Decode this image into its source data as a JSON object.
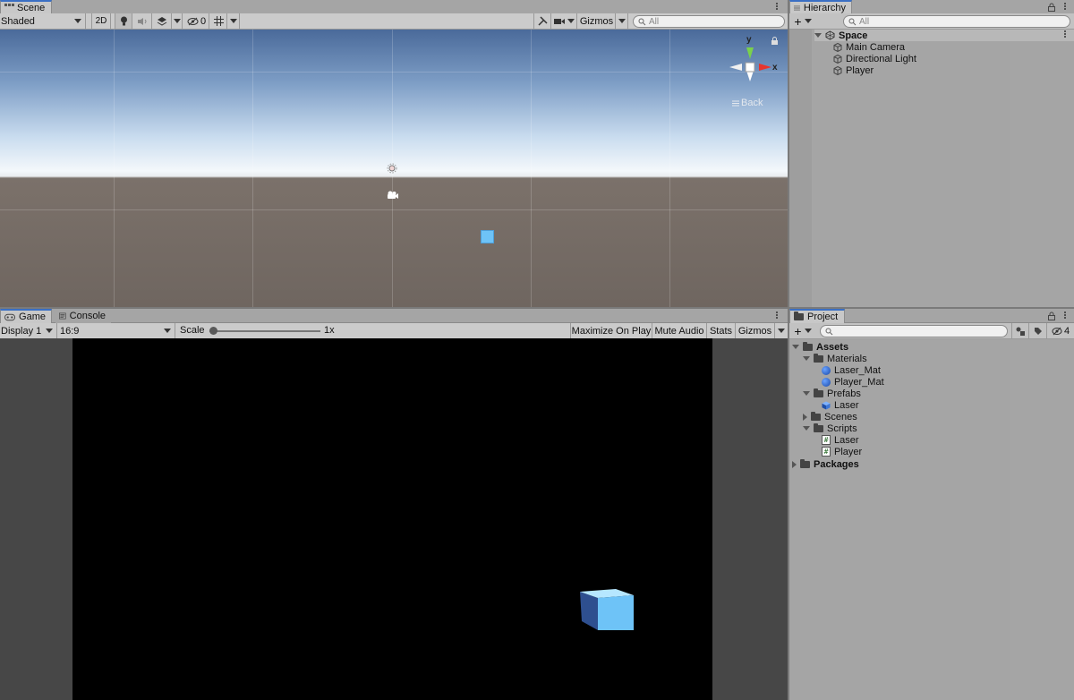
{
  "scene_tab": {
    "label": "Scene"
  },
  "scene_toolbar": {
    "shading_mode": "Shaded",
    "mode_2d": "2D",
    "hidden_count": "0",
    "gizmos_label": "Gizmos",
    "search_placeholder": "All"
  },
  "scene_gizmo": {
    "y_label": "y",
    "x_label": "x",
    "view_label": "Back"
  },
  "hierarchy": {
    "tab_label": "Hierarchy",
    "search_placeholder": "All",
    "scene_name": "Space",
    "items": [
      {
        "label": "Main Camera"
      },
      {
        "label": "Directional Light"
      },
      {
        "label": "Player"
      }
    ]
  },
  "game_tabs": [
    {
      "label": "Game"
    },
    {
      "label": "Console"
    }
  ],
  "game_toolbar": {
    "display": "Display 1",
    "aspect": "16:9",
    "scale_label": "Scale",
    "scale_value": "1x",
    "scale_fraction": 0,
    "maximize_label": "Maximize On Play",
    "mute_label": "Mute Audio",
    "stats_label": "Stats",
    "gizmos_label": "Gizmos"
  },
  "project": {
    "tab_label": "Project",
    "hidden_count": "4",
    "tree": {
      "assets": "Assets",
      "materials": "Materials",
      "laser_mat": "Laser_Mat",
      "player_mat": "Player_Mat",
      "prefabs": "Prefabs",
      "laser_prefab": "Laser",
      "scenes": "Scenes",
      "scripts": "Scripts",
      "laser_script": "Laser",
      "player_script": "Player",
      "packages": "Packages"
    }
  },
  "colors": {
    "selected_tab_accent": "#3a6fc4",
    "cube_color": "#6ec3f7",
    "material_blue": "#1847a8"
  }
}
